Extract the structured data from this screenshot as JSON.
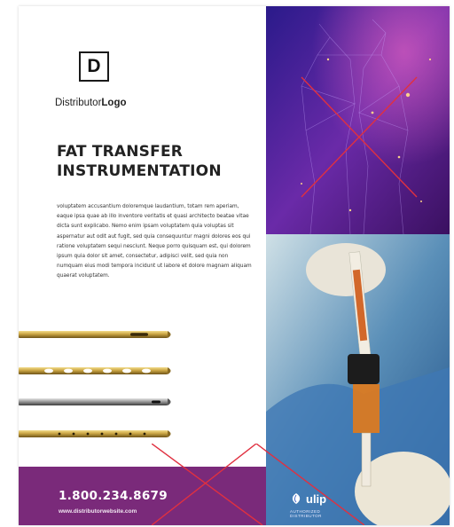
{
  "logo": {
    "letter": "D",
    "prefix": "Distributor",
    "bold": "Logo"
  },
  "title_lines": [
    "FAT TRANSFER",
    "INSTRUMENTATION"
  ],
  "body_text": "voluptatem accusantium doloremque laudantium, totam rem aperiam, eaque ipsa quae ab illo inventore veritatis et quasi architecto beatae vitae dicta sunt explicabo. Nemo enim ipsam voluptatem quia voluptas sit aspernatur aut odit aut fugit, sed quia consequuntur magni dolores eos qui ratione voluptatem sequi nesciunt. Neque porro quisquam est, qui dolorem ipsum quia dolor sit amet, consectetur, adipisci velit, sed quia non numquam eius modi tempora incidunt ut labore et dolore magnam aliquam quaerat voluptatem.",
  "contact": {
    "phone": "1.800.234.8679",
    "website": "www.distributorwebsite.com"
  },
  "brand": {
    "name": "ulip",
    "sub_line1": "AUTHORIZED",
    "sub_line2": "DISTRIBUTOR"
  },
  "colors": {
    "band": "#7a2a7a",
    "placeholder_x": "#e03040",
    "gold": "#b8953a"
  }
}
